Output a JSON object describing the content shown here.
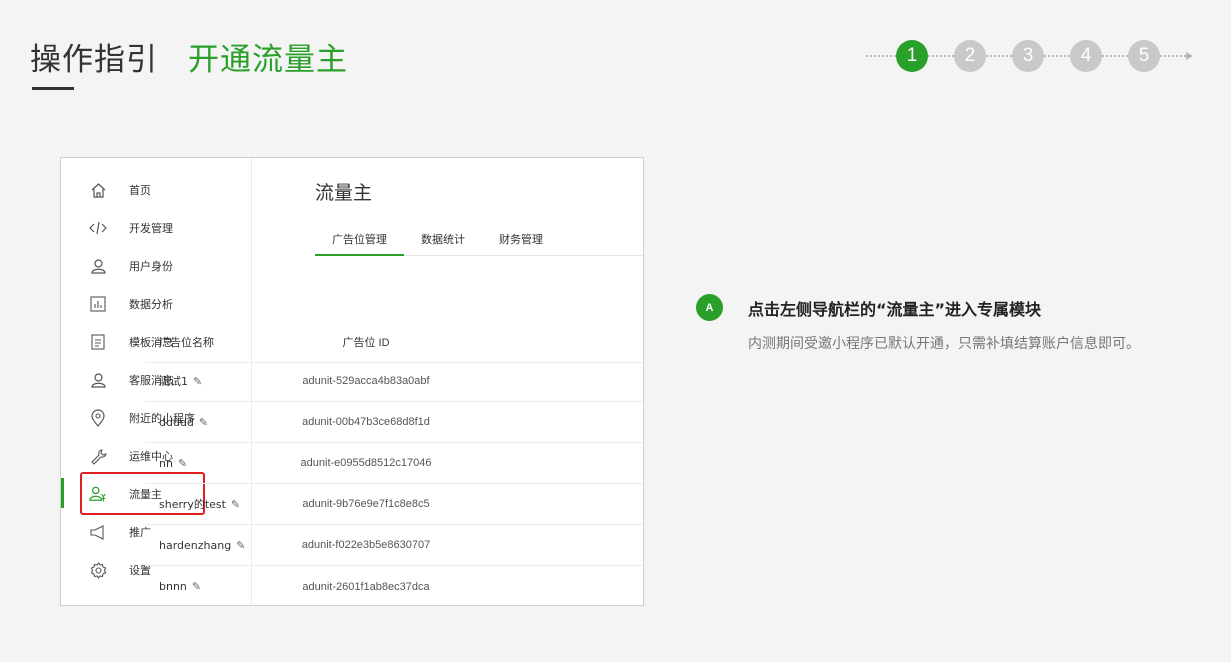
{
  "header": {
    "title": "操作指引",
    "subtitle": "开通流量主"
  },
  "steps": [
    "1",
    "2",
    "3",
    "4",
    "5"
  ],
  "active_step": 1,
  "colors": {
    "accent": "#2aa02a",
    "highlight_box": "#e02020",
    "inactive_step": "#c9c9c9"
  },
  "mock": {
    "sidebar": [
      {
        "label": "首页",
        "icon": "home-icon"
      },
      {
        "label": "开发管理",
        "icon": "code-icon"
      },
      {
        "label": "用户身份",
        "icon": "user-icon"
      },
      {
        "label": "数据分析",
        "icon": "bar-chart-icon"
      },
      {
        "label": "模板消息",
        "icon": "document-icon"
      },
      {
        "label": "客服消息",
        "icon": "customer-service-icon"
      },
      {
        "label": "附近的小程序",
        "icon": "location-pin-icon"
      },
      {
        "label": "运维中心",
        "icon": "wrench-icon"
      },
      {
        "label": "流量主",
        "icon": "traffic-user-icon"
      },
      {
        "label": "推广",
        "icon": "megaphone-icon"
      },
      {
        "label": "设置",
        "icon": "gear-icon"
      }
    ],
    "active_item": "流量主",
    "page_title": "流量主",
    "tabs": [
      "广告位管理",
      "数据统计",
      "财务管理"
    ],
    "active_tab": "广告位管理",
    "table": {
      "headers": [
        "广告位名称",
        "广告位 ID"
      ],
      "rows": [
        {
          "name": "测试1",
          "id": "adunit-529acca4b83a0abf"
        },
        {
          "name": "ddddd",
          "id": "adunit-00b47b3ce68d8f1d"
        },
        {
          "name": "nn",
          "id": "adunit-e0955d8512c17046"
        },
        {
          "name": "sherry的test",
          "id": "adunit-9b76e9e7f1c8e8c5"
        },
        {
          "name": "hardenzhang",
          "id": "adunit-f022e3b5e8630707"
        },
        {
          "name": "bnnn",
          "id": "adunit-2601f1ab8ec37dca"
        }
      ]
    }
  },
  "info": {
    "badge": "A",
    "title": "点击左侧导航栏的“流量主”进入专属模块",
    "description": "内测期间受邀小程序已默认开通，只需补填结算账户信息即可。"
  }
}
